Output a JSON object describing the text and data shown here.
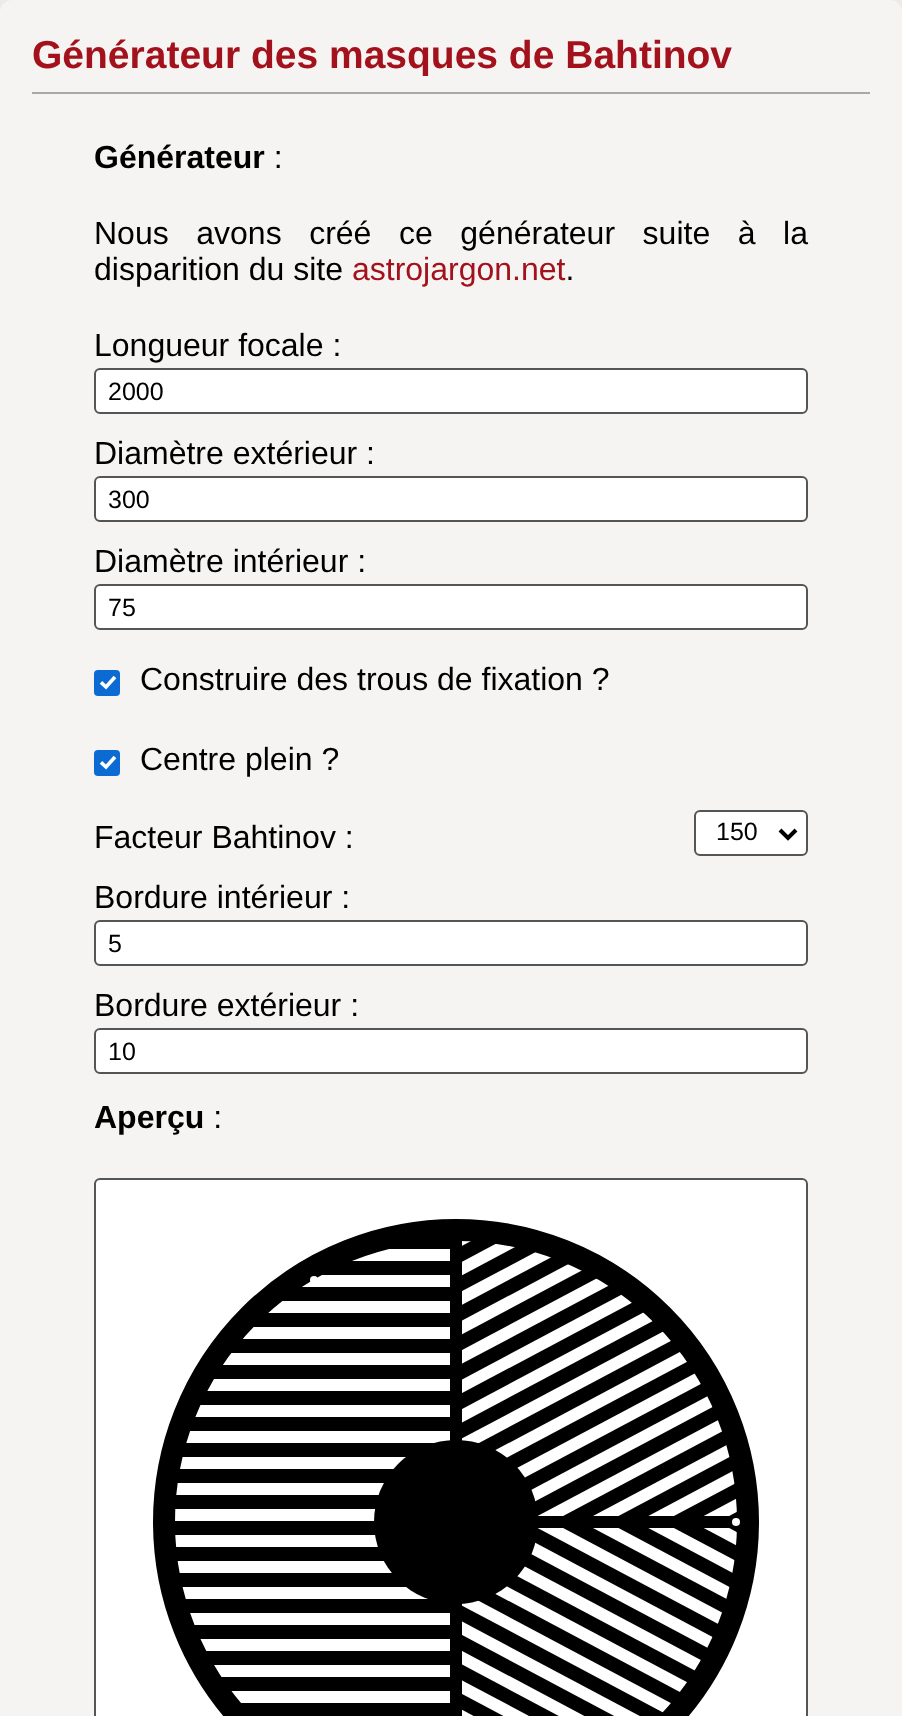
{
  "title": "Générateur des masques de Bahtinov",
  "section_label": "**Générateur** :",
  "intro": {
    "text": "Nous avons créé ce générateur suite à la disparition du site",
    "link": "astrojargon.net",
    "after": "."
  },
  "fields": [
    {
      "kind": "text",
      "label": "Longueur focale :",
      "value": "2000"
    },
    {
      "kind": "text",
      "label": "Diamètre extérieur :",
      "value": "300"
    },
    {
      "kind": "text",
      "label": "Diamètre intérieur :",
      "value": "75"
    },
    {
      "kind": "checkbox",
      "label": "Construire des trous de fixation ?",
      "checked": true
    },
    {
      "kind": "checkbox",
      "label": "Centre plein ?",
      "checked": true
    },
    {
      "kind": "select",
      "label": "Facteur Bahtinov :",
      "value": "150"
    },
    {
      "kind": "text",
      "label": "Bordure intérieur :",
      "value": "5"
    },
    {
      "kind": "text",
      "label": "Bordure extérieur :",
      "value": "10"
    }
  ],
  "preview_label": "**Aperçu** :"
}
